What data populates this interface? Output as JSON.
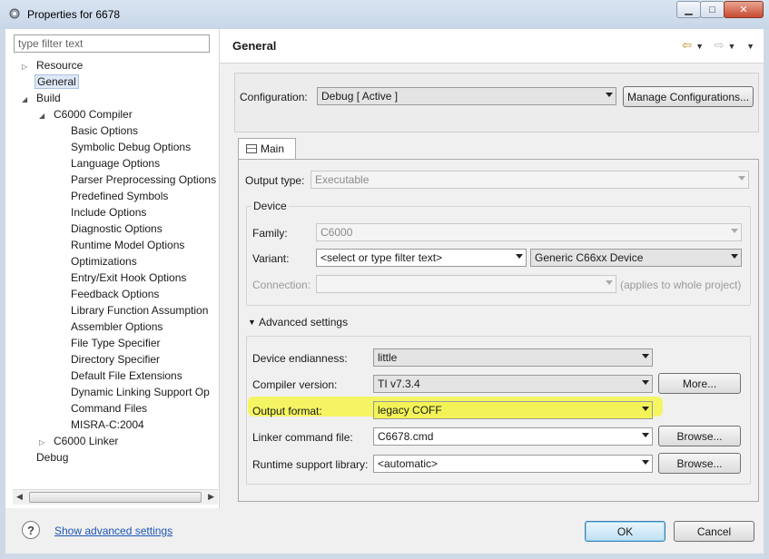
{
  "window": {
    "title": "Properties for 6678",
    "controls": {
      "minimize": "▁",
      "maximize": "□",
      "close": "✕"
    }
  },
  "tree": {
    "filter_placeholder": "type filter text",
    "items": [
      {
        "label": "Resource",
        "toggle": "▷"
      },
      {
        "label": "General",
        "toggle": ""
      },
      {
        "label": "Build",
        "toggle": "◢"
      },
      {
        "label": "C6000 Compiler",
        "toggle": "◢"
      },
      {
        "label": "Basic Options"
      },
      {
        "label": "Symbolic Debug Options"
      },
      {
        "label": "Language Options"
      },
      {
        "label": "Parser Preprocessing Options"
      },
      {
        "label": "Predefined Symbols"
      },
      {
        "label": "Include Options"
      },
      {
        "label": "Diagnostic Options"
      },
      {
        "label": "Runtime Model Options"
      },
      {
        "label": "Optimizations"
      },
      {
        "label": "Entry/Exit Hook Options"
      },
      {
        "label": "Feedback Options"
      },
      {
        "label": "Library Function Assumption"
      },
      {
        "label": "Assembler Options"
      },
      {
        "label": "File Type Specifier"
      },
      {
        "label": "Directory Specifier"
      },
      {
        "label": "Default File Extensions"
      },
      {
        "label": "Dynamic Linking Support Op"
      },
      {
        "label": "Command Files"
      },
      {
        "label": "MISRA-C:2004"
      },
      {
        "label": "C6000 Linker",
        "toggle": "▷"
      },
      {
        "label": "Debug",
        "toggle": ""
      }
    ],
    "selected": "General"
  },
  "header": {
    "title": "General"
  },
  "configuration": {
    "label": "Configuration:",
    "value": "Debug  [ Active ]",
    "manage_button": "Manage Configurations..."
  },
  "tab": {
    "label": "Main"
  },
  "main": {
    "output_type_label": "Output type:",
    "output_type_value": "Executable",
    "device_legend": "Device",
    "family_label": "Family:",
    "family_value": "C6000",
    "variant_label": "Variant:",
    "variant_filter": "<select or type filter text>",
    "variant_value": "Generic C66xx Device",
    "connection_label": "Connection:",
    "connection_value": "",
    "connection_note": "(applies to whole project)",
    "advanced_toggle": "▼",
    "advanced_label": "Advanced settings",
    "endianness_label": "Device endianness:",
    "endianness_value": "little",
    "compiler_label": "Compiler version:",
    "compiler_value": "TI v7.3.4",
    "more_button": "More...",
    "output_format_label": "Output format:",
    "output_format_value": "legacy COFF",
    "linker_cmd_label": "Linker command file:",
    "linker_cmd_value": "C6678.cmd",
    "browse_button": "Browse...",
    "runtime_lib_label": "Runtime support library:",
    "runtime_lib_value": "<automatic>",
    "browse_button2": "Browse..."
  },
  "footer": {
    "help": "?",
    "advanced_link": "Show advanced settings",
    "ok_button": "OK",
    "cancel_button": "Cancel"
  },
  "colors": {
    "highlight": "#f6f64a",
    "link": "#1a55b5",
    "ok_border": "#3c7fb1"
  }
}
